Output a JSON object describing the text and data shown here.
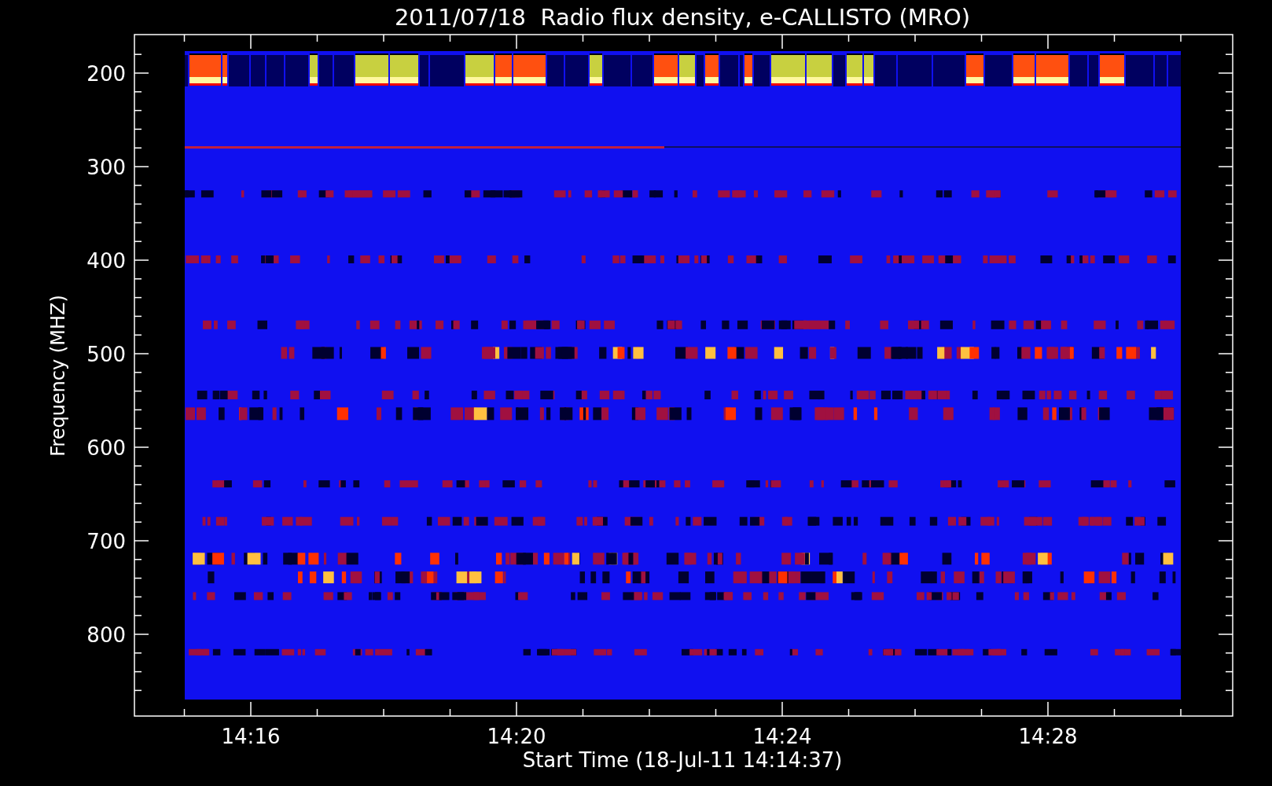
{
  "title": "2011/07/18  Radio flux density, e-CALLISTO (MRO)",
  "y_axis": {
    "label": "Frequency (MHZ)",
    "ticks": [
      "200",
      "300",
      "400",
      "500",
      "600",
      "700",
      "800"
    ]
  },
  "x_axis": {
    "label": "Start Time (18-Jul-11 14:14:37)",
    "ticks": [
      "14:16",
      "14:20",
      "14:24",
      "14:28"
    ]
  }
}
